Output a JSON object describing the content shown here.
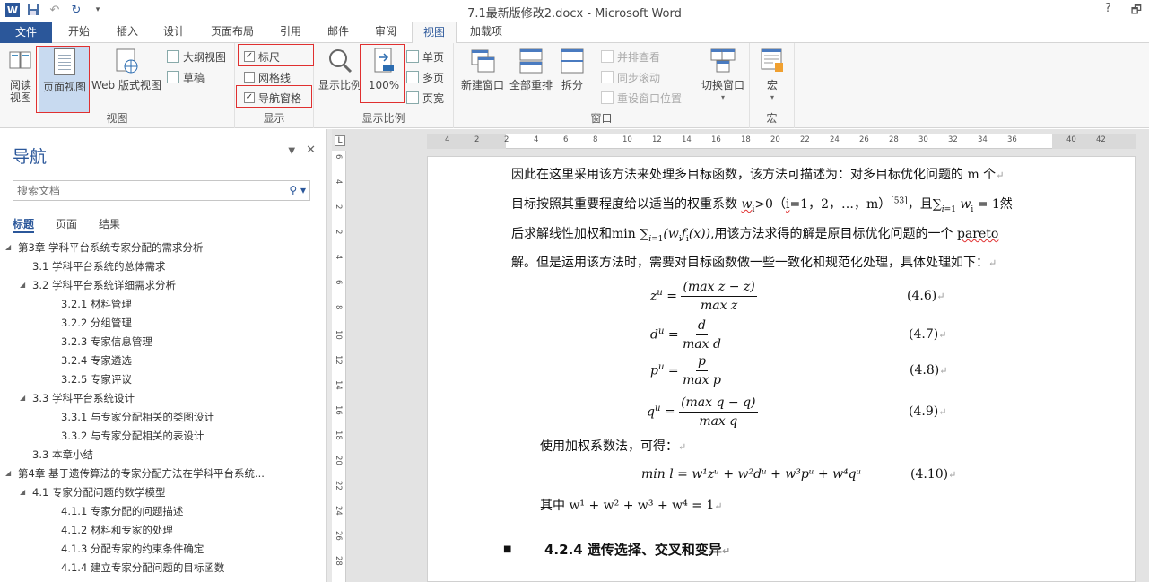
{
  "app": {
    "title": "7.1最新版修改2.docx - Microsoft Word",
    "help": "?",
    "restore": "🗗"
  },
  "tabs": [
    {
      "label": "文件"
    },
    {
      "label": "开始"
    },
    {
      "label": "插入"
    },
    {
      "label": "设计"
    },
    {
      "label": "页面布局"
    },
    {
      "label": "引用"
    },
    {
      "label": "邮件"
    },
    {
      "label": "审阅"
    },
    {
      "label": "视图"
    },
    {
      "label": "加载项"
    }
  ],
  "ribbon": {
    "view_group": {
      "label": "视图",
      "read_mode": "阅读\n视图",
      "print_layout": "页面视图",
      "web_layout": "Web 版式视图",
      "outline": "大纲视图",
      "draft": "草稿"
    },
    "show_group": {
      "label": "显示",
      "ruler": "标尺",
      "gridlines": "网格线",
      "nav_pane": "导航窗格",
      "ruler_checked": true,
      "gridlines_checked": false,
      "nav_checked": true
    },
    "zoom_group": {
      "label": "显示比例",
      "zoom": "显示比例",
      "hundred": "100%",
      "one_page": "单页",
      "multi_page": "多页",
      "page_width": "页宽"
    },
    "window_group": {
      "label": "窗口",
      "new_window": "新建窗口",
      "arrange_all": "全部重排",
      "split": "拆分",
      "side_by_side": "并排查看",
      "sync_scroll": "同步滚动",
      "reset_pos": "重设窗口位置",
      "switch": "切换窗口"
    },
    "macro_group": {
      "label": "宏",
      "macros": "宏"
    }
  },
  "nav": {
    "title": "导航",
    "search_placeholder": "搜索文档",
    "tabs": [
      "标题",
      "页面",
      "结果"
    ],
    "items": [
      {
        "label": "第3章 学科平台系统专家分配的需求分析",
        "level": 1,
        "expand": true
      },
      {
        "label": "3.1 学科平台系统的总体需求",
        "level": 2,
        "expand": false
      },
      {
        "label": "3.2 学科平台系统详细需求分析",
        "level": 2,
        "expand": true
      },
      {
        "label": "3.2.1 材料管理",
        "level": 3,
        "expand": false
      },
      {
        "label": "3.2.2 分组管理",
        "level": 3,
        "expand": false
      },
      {
        "label": "3.2.3 专家信息管理",
        "level": 3,
        "expand": false
      },
      {
        "label": "3.2.4 专家遴选",
        "level": 3,
        "expand": false
      },
      {
        "label": "3.2.5 专家评议",
        "level": 3,
        "expand": false
      },
      {
        "label": "3.3 学科平台系统设计",
        "level": 2,
        "expand": true
      },
      {
        "label": "3.3.1 与专家分配相关的类图设计",
        "level": 3,
        "expand": false
      },
      {
        "label": "3.3.2 与专家分配相关的表设计",
        "level": 3,
        "expand": false
      },
      {
        "label": "3.3 本章小结",
        "level": 2,
        "expand": false
      },
      {
        "label": "第4章 基于遗传算法的专家分配方法在学科平台系统...",
        "level": 1,
        "expand": true
      },
      {
        "label": "4.1 专家分配问题的数学模型",
        "level": 2,
        "expand": true
      },
      {
        "label": "4.1.1 专家分配的问题描述",
        "level": 3,
        "expand": false
      },
      {
        "label": "4.1.2 材料和专家的处理",
        "level": 3,
        "expand": false
      },
      {
        "label": "4.1.3 分配专家的约束条件确定",
        "level": 3,
        "expand": false
      },
      {
        "label": "4.1.4 建立专家分配问题的目标函数",
        "level": 3,
        "expand": false
      }
    ]
  },
  "ruler": {
    "h_ticks": [
      "4",
      "2",
      "2",
      "4",
      "6",
      "8",
      "10",
      "12",
      "14",
      "16",
      "18",
      "20",
      "22",
      "24",
      "26",
      "28",
      "30",
      "32",
      "34",
      "36",
      "40",
      "42"
    ],
    "v_ticks": [
      "6",
      "4",
      "2",
      "2",
      "4",
      "6",
      "8",
      "10",
      "12",
      "14",
      "16",
      "18",
      "20",
      "22",
      "24",
      "26",
      "28"
    ]
  },
  "document": {
    "line1": "因此在这里采用该方法来处理多目标函数，该方法可描述为：对多目标优化问题的 m 个",
    "line2a": "目标按照其重要程度给以适当的权重系数 ",
    "line2b": "w",
    "line2c": "i",
    "line2d": ">0（",
    "line2e": "i",
    "line2f": "=1，2，…，m）",
    "line2g": "[53]",
    "line2h": "，且∑",
    "line2i": " w",
    "line2j": "i",
    "line2k": " = 1然",
    "line3a": "后求解线性加权和min ∑",
    "line3b": "(w",
    "line3c": "i",
    "line3d": "f",
    "line3e": "i",
    "line3f": "(x))",
    "line3g": ",用该方法求得的解是原目标优化问题的一个 ",
    "line3h": "pareto",
    "line4": "解。但是运用该方法时，需要对目标函数做一些一致化和规范化处理，具体处理如下：",
    "return_mark": "↵",
    "eq46": {
      "lhs": "z",
      "sup": "u",
      "num": "(max z − z)",
      "den": "max z",
      "no": "(4.6)"
    },
    "eq47": {
      "lhs": "d",
      "sup": "u",
      "num": "d",
      "den": "max d",
      "no": "(4.7)"
    },
    "eq48": {
      "lhs": "p",
      "sup": "u",
      "num": "p",
      "den": "max p",
      "no": "(4.8)"
    },
    "eq49": {
      "lhs": "q",
      "sup": "u",
      "num": "(max q − q)",
      "den": "max q",
      "no": "(4.9)"
    },
    "text_weighted": "使用加权系数法，可得：",
    "eq410": {
      "text": "min l =  w¹zᵘ + w²dᵘ  + w³pᵘ   + w⁴qᵘ",
      "no": "(4.10)"
    },
    "text_where": "其中 w¹  + w²  + w³ + w⁴ = 1",
    "heading": "4.2.4 遗传选择、交叉和变异"
  }
}
